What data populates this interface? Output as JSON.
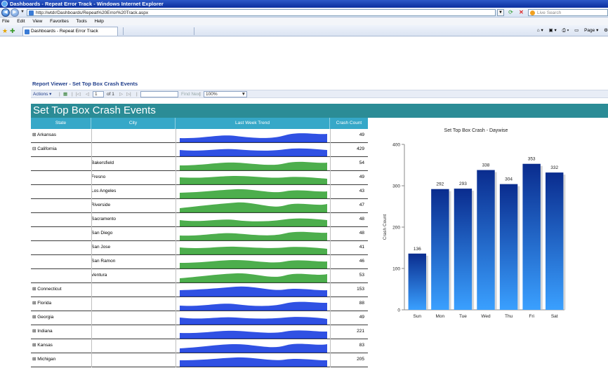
{
  "window": {
    "title": "Dashboards - Repeat Error Track - Windows Internet Explorer"
  },
  "address": {
    "url": "http://wtdr/Dashboards/Repeat%20Error%20Track.aspx",
    "search_placeholder": "Live Search"
  },
  "menu": [
    "File",
    "Edit",
    "View",
    "Favorites",
    "Tools",
    "Help"
  ],
  "tab": {
    "title": "Dashboards - Repeat Error Track"
  },
  "command_bar": {
    "page": "Page"
  },
  "report": {
    "viewer_title": "Report Viewer - Set Top Box Crash Events",
    "actions_label": "Actions",
    "page_current": "1",
    "page_of": "of 1",
    "find_label": "Find Next",
    "zoom": "100%"
  },
  "banner": {
    "title": "Set Top Box Crash Events"
  },
  "table": {
    "headers": [
      "State",
      "City",
      "Last Week Trend",
      "Crash Count"
    ],
    "rows": [
      {
        "state": "⊞ Arkansas",
        "city": "",
        "count": "49",
        "color": "blue"
      },
      {
        "state": "⊟ California",
        "city": "",
        "count": "429",
        "color": "blue"
      },
      {
        "state": "",
        "city": "Bakersfield",
        "count": "54",
        "color": "green"
      },
      {
        "state": "",
        "city": "Fresno",
        "count": "49",
        "color": "green"
      },
      {
        "state": "",
        "city": "Los Angeles",
        "count": "43",
        "color": "green"
      },
      {
        "state": "",
        "city": "Riverside",
        "count": "47",
        "color": "green"
      },
      {
        "state": "",
        "city": "Sacramento",
        "count": "48",
        "color": "green"
      },
      {
        "state": "",
        "city": "San Diego",
        "count": "48",
        "color": "green"
      },
      {
        "state": "",
        "city": "San Jose",
        "count": "41",
        "color": "green"
      },
      {
        "state": "",
        "city": "San Ramon",
        "count": "46",
        "color": "green"
      },
      {
        "state": "",
        "city": "Ventura",
        "count": "53",
        "color": "green"
      },
      {
        "state": "⊞ Connecticut",
        "city": "",
        "count": "153",
        "color": "blue"
      },
      {
        "state": "⊞ Florida",
        "city": "",
        "count": "88",
        "color": "blue"
      },
      {
        "state": "⊞ Georgia",
        "city": "",
        "count": "49",
        "color": "blue"
      },
      {
        "state": "⊞ Indiana",
        "city": "",
        "count": "221",
        "color": "blue"
      },
      {
        "state": "⊞ Kansas",
        "city": "",
        "count": "83",
        "color": "blue"
      },
      {
        "state": "⊞ Michigan",
        "city": "",
        "count": "205",
        "color": "blue"
      }
    ],
    "colors": {
      "blue": "#1a3ee0",
      "green": "#3aa53a",
      "header_bg": "#36a8c8",
      "banner_bg": "#2b8c96"
    }
  },
  "chart_data": {
    "type": "bar",
    "title": "Set Top Box Crash  - Daywise",
    "ylabel": "Crash Count",
    "xlabel": "",
    "categories": [
      "Sun",
      "Mon",
      "Tue",
      "Wed",
      "Thu",
      "Fri",
      "Sat"
    ],
    "values": [
      136,
      292,
      293,
      338,
      304,
      353,
      332
    ],
    "yticks": [
      0,
      100,
      200,
      300,
      400
    ],
    "ylim": [
      0,
      400
    ],
    "grid": false,
    "legend": "none",
    "bar_color_top": "#0a2c8e",
    "bar_color_bottom": "#3aa0ff"
  }
}
